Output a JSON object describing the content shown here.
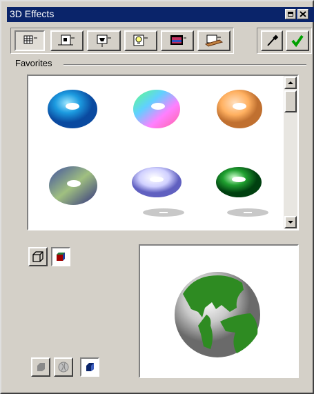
{
  "window": {
    "title": "3D Effects"
  },
  "toolbar": {
    "tabs": [
      "favorites-tab",
      "lighting-tab",
      "bevel-tab",
      "light-bulb-tab",
      "texture-tab",
      "material-tab"
    ],
    "icons": [
      "eyedropper-icon",
      "checkmark-icon"
    ]
  },
  "favorites": {
    "label": "Favorites"
  },
  "gallery": {
    "items": [
      {
        "name": "blue-torus"
      },
      {
        "name": "rainbow-torus"
      },
      {
        "name": "orange-torus"
      },
      {
        "name": "dark-blue-torus"
      },
      {
        "name": "white-torus"
      },
      {
        "name": "green-torus"
      }
    ]
  },
  "preview": {
    "subject": "green-globe"
  },
  "colors": {
    "titlebar": "#0a246a",
    "face": "#d4d0c8",
    "check": "#00a000",
    "globe": "#2e8b22"
  }
}
